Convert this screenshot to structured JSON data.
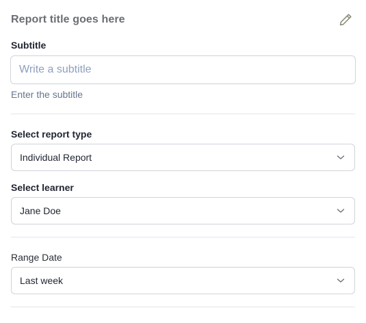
{
  "report": {
    "title": "Report title goes here"
  },
  "subtitle": {
    "label": "Subtitle",
    "placeholder": "Write a subtitle",
    "value": "",
    "helper": "Enter the subtitle"
  },
  "report_type": {
    "label": "Select report type",
    "selected": "Individual Report"
  },
  "learner": {
    "label": "Select learner",
    "selected": "Jane Doe"
  },
  "range_date": {
    "label": "Range Date",
    "selected": "Last week"
  },
  "icons": {
    "edit": "pencil-icon",
    "chevron": "chevron-down-icon"
  },
  "colors": {
    "title": "#6b6e73",
    "placeholder": "#8c9fbd",
    "helper": "#66758d",
    "border": "#cfd3d9",
    "divider": "#e2e5ea",
    "icon": "#8a8f7a"
  }
}
